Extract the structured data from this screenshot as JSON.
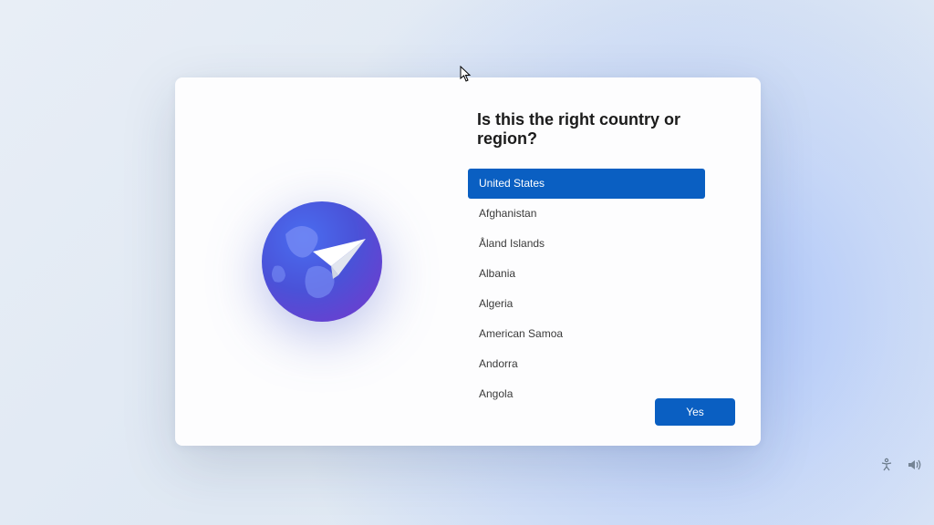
{
  "title": "Is this the right country or region?",
  "countries": {
    "selected_index": 0,
    "items": [
      "United States",
      "Afghanistan",
      "Åland Islands",
      "Albania",
      "Algeria",
      "American Samoa",
      "Andorra",
      "Angola"
    ]
  },
  "yes_label": "Yes"
}
